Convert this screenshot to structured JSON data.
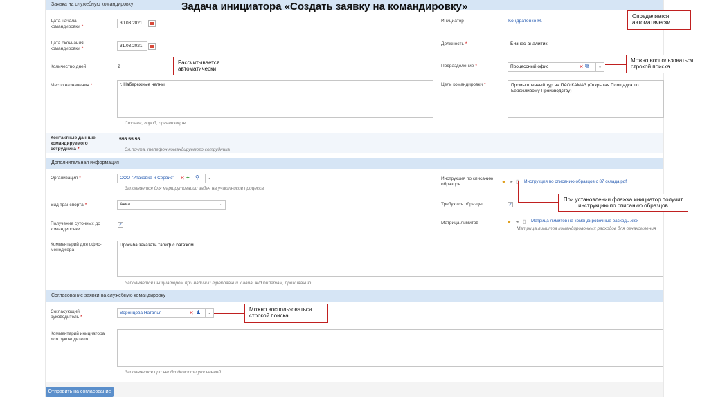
{
  "slide_title": "Задача инициатора «Создать заявку на командировку»",
  "sections": {
    "trip_request": "Заявка на служебную командировку",
    "additional": "Дополнительная информация",
    "approval": "Согласование заявки на служебную командировку"
  },
  "fields": {
    "start_date_label": "Дата начала командировки",
    "start_date_value": "30.03.2021",
    "end_date_label": "Дата окончания командировки",
    "end_date_value": "31.03.2021",
    "days_label": "Количество дней",
    "days_value": "2",
    "destination_label": "Место назначения",
    "destination_value": "г. Набережные челны",
    "destination_hint": "Страна, город, организация",
    "initiator_label": "Инициатор",
    "initiator_value": "Кондратенко Н.",
    "position_label": "Должность",
    "position_value": "Бизнес-аналитик",
    "department_label": "Подразделение",
    "department_value": "Процессный офис",
    "purpose_label": "Цель командировки",
    "purpose_value": "Промышленный тур на ПАО КАМАЗ (Открытая Площадка по Бережливому Производству)",
    "contacts_label": "Контактные данные командируемого сотрудника",
    "contacts_value": "555 55 55",
    "contacts_hint": "Эл.почта, телефон командируемого сотрудника",
    "org_label": "Организация",
    "org_value": "ООО \"Упаковка и Сервис\"",
    "org_hint": "Заполняется для маршрутизации задач на участников процесса",
    "transport_label": "Вид транспорта",
    "transport_value": "Авиа",
    "per_diem_label": "Получение суточных до командировки",
    "office_comment_label": "Комментарий для офис-менеджера",
    "office_comment_value": "Просьба заказать тариф с багажом",
    "office_comment_hint": "Заполняется инициатором при наличии требований к авиа, ж/д билетам, проживанию",
    "instruction_label": "Инструкция по списанию образцов",
    "instruction_file": "Инструкция по списанию образцов с 87 склада.pdf",
    "samples_label": "Требуются образцы",
    "limits_label": "Матрица лимитов",
    "limits_file": "Матрица лимитов на командировочные расходы.xlsx",
    "limits_hint": "Матрица лимитов командировочных расходов для ознакомления",
    "manager_label": "Согласующий руководитель",
    "manager_value": "Воронцова Наталья",
    "manager_comment_label": "Комментарий инициатора для руководителя",
    "manager_comment_hint": "Заполняется при необходимости уточнений"
  },
  "callouts": {
    "auto_initiator": "Определяется автоматически",
    "auto_days": "Рассчитывается автоматически",
    "search_dept": "Можно воспользоваться строкой поиска",
    "samples_flag": "При установлении флажка инициатор получит инструкцию по списанию образцов",
    "search_manager": "Можно воспользоваться строкой поиска"
  },
  "buttons": {
    "submit": "Отправить на согласование"
  },
  "colors": {
    "section_bg": "#d6e5f5",
    "accent": "#2b5fb3",
    "callout_border": "#c02020",
    "button": "#5b8fcb"
  }
}
